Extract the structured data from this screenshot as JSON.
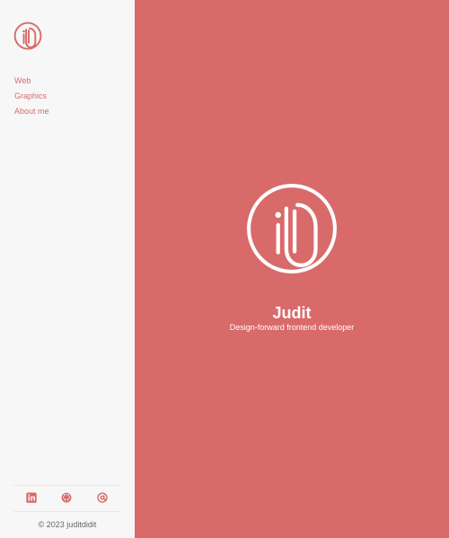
{
  "brand": {
    "logo_icon": "jd-monogram-logo-icon",
    "name": "Judit",
    "tagline": "Design-forward frontend developer"
  },
  "nav": {
    "items": [
      {
        "label": "Web"
      },
      {
        "label": "Graphics"
      },
      {
        "label": "About me"
      }
    ]
  },
  "social": {
    "icons": [
      "linkedin-icon",
      "github-icon",
      "mail-icon"
    ]
  },
  "footer": {
    "copyright": "© 2023 juditdidit"
  },
  "colors": {
    "accent": "#d96a6a",
    "sidebar_bg": "#f7f7f7",
    "text_muted": "#666666",
    "hero_text": "#ffffff"
  }
}
